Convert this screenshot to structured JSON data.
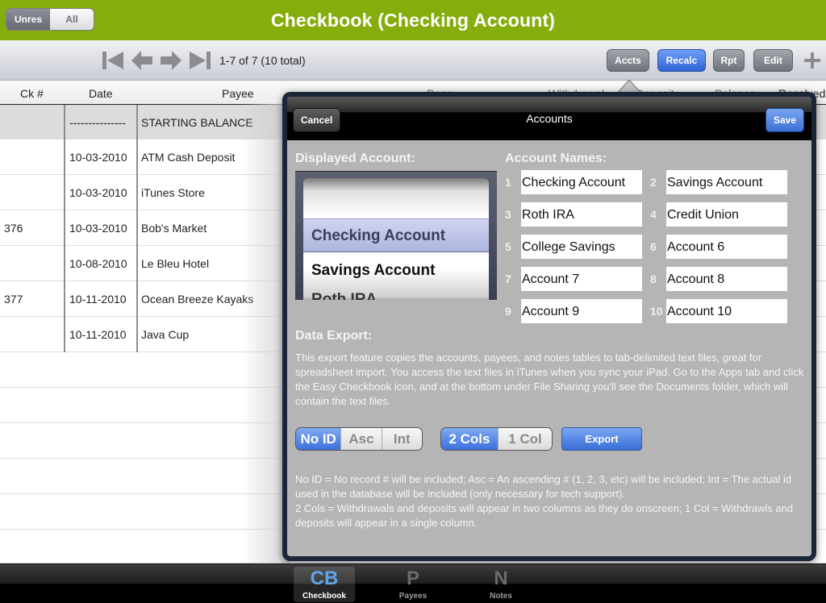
{
  "app": {
    "title": "Checkbook (Checking Account)"
  },
  "toolbar": {
    "filter": {
      "options": [
        "Unres",
        "All"
      ],
      "selected": "Unres"
    },
    "nav_icons": [
      "first-record-icon",
      "previous-record-icon",
      "next-record-icon",
      "last-record-icon"
    ],
    "record_count": "1-7 of 7 (10 total)",
    "buttons": {
      "accts": "Accts",
      "recalc": "Recalc",
      "rpt": "Rpt",
      "edit": "Edit"
    },
    "add_icon": "plus-icon"
  },
  "columns": [
    "Ck #",
    "Date",
    "Payee",
    "Desc",
    "Withdrawal",
    "Deposit",
    "Balance",
    "Resolved"
  ],
  "rows": [
    {
      "ck": "",
      "date": "---------------",
      "payee": "STARTING BALANCE"
    },
    {
      "ck": "",
      "date": "10-03-2010",
      "payee": "ATM Cash Deposit"
    },
    {
      "ck": "",
      "date": "10-03-2010",
      "payee": "iTunes Store"
    },
    {
      "ck": "376",
      "date": "10-03-2010",
      "payee": "Bob's Market"
    },
    {
      "ck": "",
      "date": "10-08-2010",
      "payee": "Le Bleu Hotel"
    },
    {
      "ck": "377",
      "date": "10-11-2010",
      "payee": "Ocean Breeze Kayaks"
    },
    {
      "ck": "",
      "date": "10-11-2010",
      "payee": "Java Cup"
    }
  ],
  "popover": {
    "title": "Accounts",
    "cancel": "Cancel",
    "save": "Save",
    "displayed_account_label": "Displayed Account:",
    "picker": {
      "items": [
        "Checking Account",
        "Savings Account",
        "Roth IRA"
      ],
      "selected": "Checking Account"
    },
    "account_names_label": "Account Names:",
    "accounts": [
      {
        "num": "1",
        "name": "Checking Account"
      },
      {
        "num": "2",
        "name": "Savings Account"
      },
      {
        "num": "3",
        "name": "Roth IRA"
      },
      {
        "num": "4",
        "name": "Credit Union"
      },
      {
        "num": "5",
        "name": "College Savings"
      },
      {
        "num": "6",
        "name": "Account 6"
      },
      {
        "num": "7",
        "name": "Account 7"
      },
      {
        "num": "8",
        "name": "Account 8"
      },
      {
        "num": "9",
        "name": "Account 9"
      },
      {
        "num": "10",
        "name": "Account 10"
      }
    ],
    "data_export_label": "Data Export:",
    "export_description": "This export feature copies the accounts, payees, and notes tables to tab-delimited text files, great for spreadsheet import. You access the text files in iTunes when you sync your iPad.  Go to the Apps tab and click the Easy Checkbook icon, and at the bottom under File Sharing you'll see the Documents folder, which will contain the text files.",
    "id_options": {
      "options": [
        "No ID",
        "Asc",
        "Int"
      ],
      "selected": "No ID"
    },
    "col_options": {
      "options": [
        "2 Cols",
        "1 Col"
      ],
      "selected": "2 Cols"
    },
    "export_button": "Export",
    "help_line1": "No ID = No record # will be included; Asc = An ascending # (1, 2, 3, etc) will be included; Int = The actual id used in the database will be included (only necessary for tech support).",
    "help_line2": "2 Cols = Withdrawals and deposits will appear in two columns as they do onscreen; 1 Col = Withdrawls and deposits will appear in a single column."
  },
  "tabbar": {
    "tabs": [
      {
        "glyph": "CB",
        "label": "Checkbook",
        "active": true
      },
      {
        "glyph": "P",
        "label": "Payees",
        "active": false
      },
      {
        "glyph": "N",
        "label": "Notes",
        "active": false
      }
    ]
  }
}
